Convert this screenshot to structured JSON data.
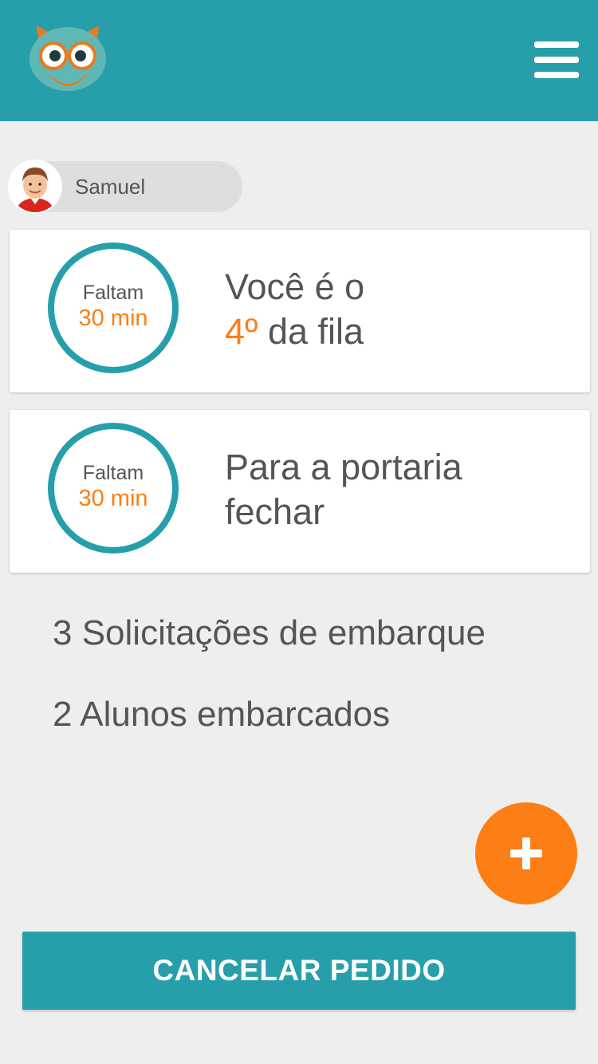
{
  "theme": {
    "primary": "#279fab",
    "accent": "#fd7e14",
    "background": "#eeeeee",
    "text": "#555555"
  },
  "header": {
    "logo_icon": "owl-logo-icon",
    "menu_icon": "hamburger-menu-icon"
  },
  "user": {
    "name": "Samuel",
    "avatar_icon": "student-avatar"
  },
  "queue_card": {
    "timer": {
      "label": "Faltam",
      "value": "30 min"
    },
    "line1": "Você é o",
    "position": "4º",
    "line2_rest": " da fila"
  },
  "gate_card": {
    "timer": {
      "label": "Faltam",
      "value": "30 min"
    },
    "line1": "Para a portaria",
    "line2": "fechar"
  },
  "stats": {
    "requests": "3 Solicitações de embarque",
    "boarded": "2 Alunos embarcados"
  },
  "fab": {
    "icon": "plus-icon"
  },
  "cancel_button": {
    "label": "CANCELAR PEDIDO"
  }
}
